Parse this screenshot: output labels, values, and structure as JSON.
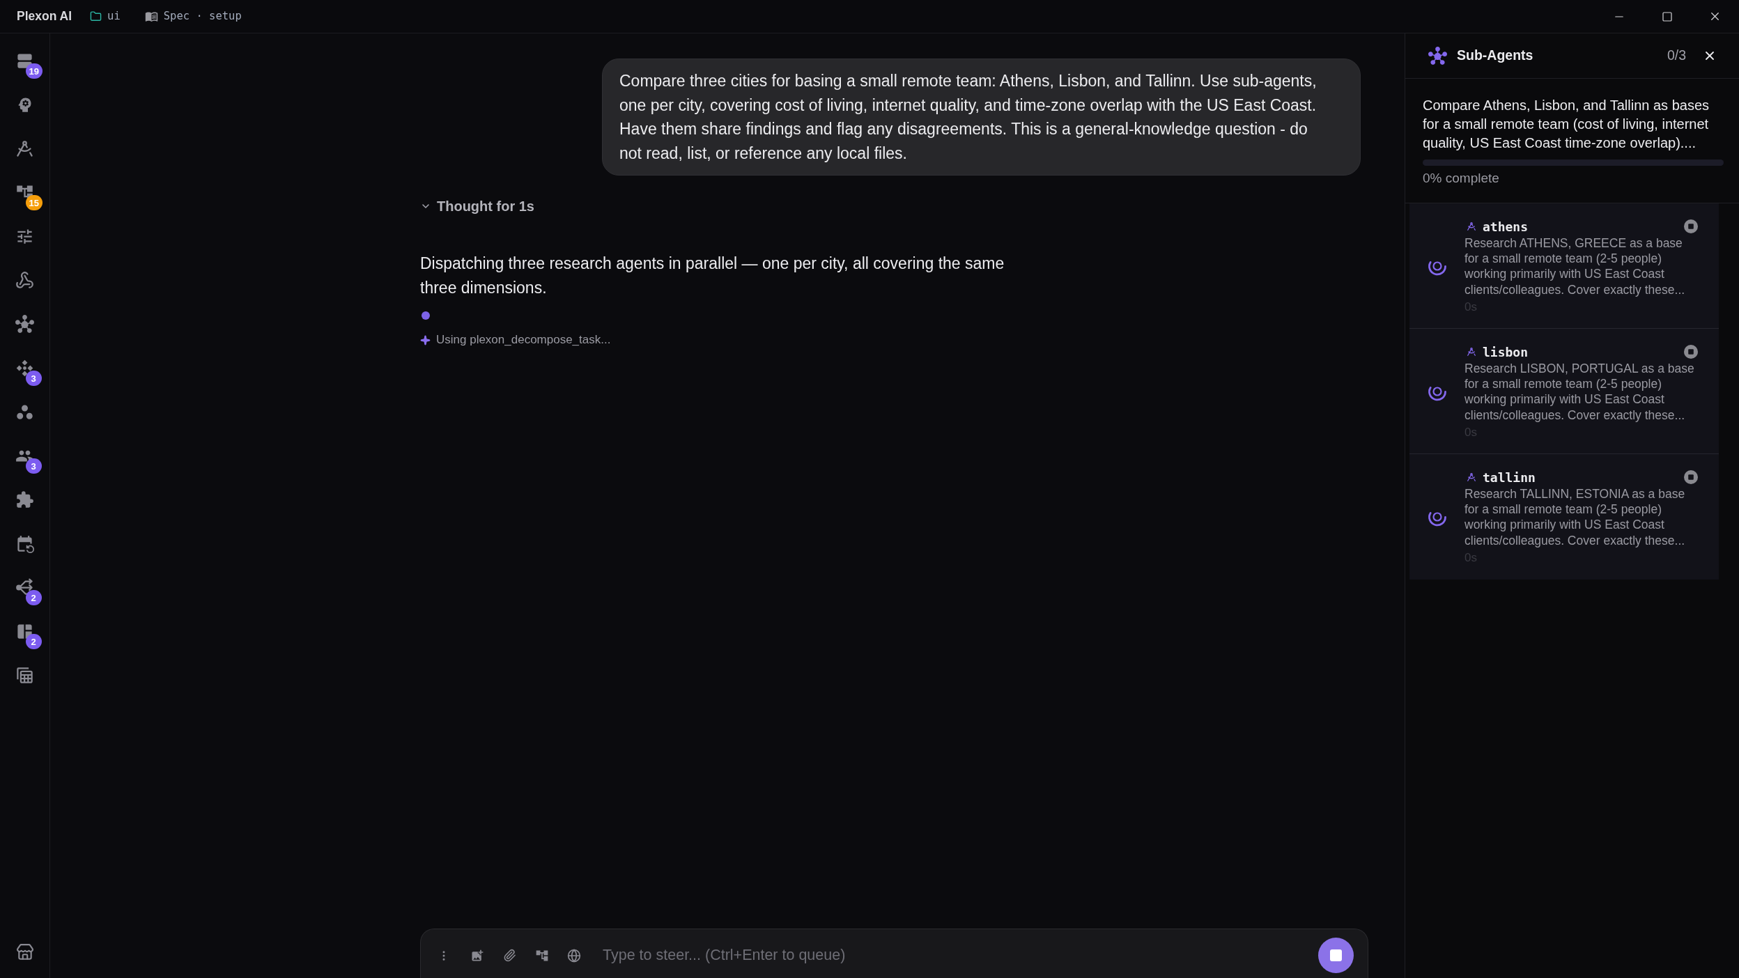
{
  "title_bar": {
    "app_name": "Plexon AI",
    "folder": "ui",
    "spec": "Spec · setup"
  },
  "sidebar": {
    "badges": [
      {
        "count": "19",
        "color": "#7c5cf0"
      },
      {
        "count": "15",
        "color": "#f59e0b"
      },
      {
        "count": "3",
        "color": "#7c5cf0"
      },
      {
        "count": "3",
        "color": "#7c5cf0"
      },
      {
        "count": "2",
        "color": "#7c5cf0"
      },
      {
        "count": "2",
        "color": "#7c5cf0"
      }
    ]
  },
  "conversation": {
    "user_message": "Compare three cities for basing a small remote team: Athens, Lisbon, and Tallinn. Use sub-agents, one per city, covering cost of living, internet quality, and time-zone overlap with the US East Coast. Have them share findings and flag any disagreements. This is a general-knowledge question - do not read, list, or reference any local files.",
    "thought": {
      "label": "Thought for 1s"
    },
    "assistant_message": "Dispatching three research agents in parallel — one per city, all covering the same three dimensions.",
    "tool_activity": "Using plexon_decompose_task..."
  },
  "composer": {
    "placeholder": "Type to steer... (Ctrl+Enter to queue)"
  },
  "sub_agents": {
    "title": "Sub-Agents",
    "count": "0/3",
    "summary": "Compare Athens, Lisbon, and Tallinn as bases for a small remote team (cost of living, internet quality, US East Coast time-zone overlap)....",
    "progress": {
      "level": 0,
      "label": "0% complete"
    },
    "agents": [
      {
        "name": "athens",
        "done": false,
        "task": "Research ATHENS, GREECE as a base for a small remote team (2-5 people) working primarily with US East Coast clients/colleagues. Cover exactly these...",
        "elapsed": "0s"
      },
      {
        "name": "lisbon",
        "done": false,
        "task": "Research LISBON, PORTUGAL as a base for a small remote team (2-5 people) working primarily with US East Coast clients/colleagues. Cover exactly these...",
        "elapsed": "0s"
      },
      {
        "name": "tallinn",
        "done": false,
        "task": "Research TALLINN, ESTONIA as a base for a small remote team (2-5 people) working primarily with US East Coast clients/colleagues. Cover exactly these...",
        "elapsed": "0s"
      }
    ]
  }
}
